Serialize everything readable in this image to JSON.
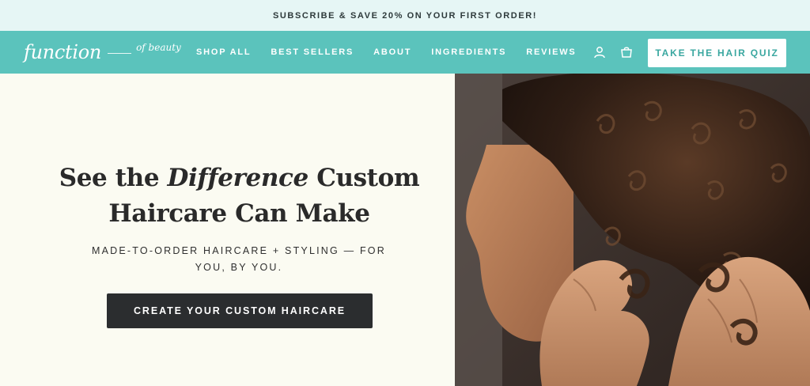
{
  "promo_bar": {
    "text": "SUBSCRIBE & SAVE 20% ON YOUR FIRST ORDER!"
  },
  "nav": {
    "logo_main": "function",
    "logo_sub": "of beauty",
    "items": [
      {
        "label": "SHOP ALL"
      },
      {
        "label": "BEST SELLERS"
      },
      {
        "label": "ABOUT"
      },
      {
        "label": "INGREDIENTS"
      },
      {
        "label": "REVIEWS"
      }
    ],
    "icons": {
      "account": "user-icon",
      "cart": "bag-icon"
    },
    "quiz_button": "TAKE THE HAIR QUIZ"
  },
  "hero": {
    "headline_pre": "See the ",
    "headline_em": "Difference",
    "headline_post": " Custom",
    "headline_line2": "Haircare Can Make",
    "subhead": "MADE-TO-ORDER HAIRCARE + STYLING — FOR YOU, BY YOU.",
    "cta_label": "CREATE YOUR CUSTOM HAIRCARE"
  },
  "colors": {
    "promo_bg": "#e6f6f5",
    "nav_bg": "#5bc3bc",
    "hero_bg": "#fbfbf2",
    "cta_bg": "#2b2d2f",
    "quiz_text": "#3aa7a0"
  }
}
